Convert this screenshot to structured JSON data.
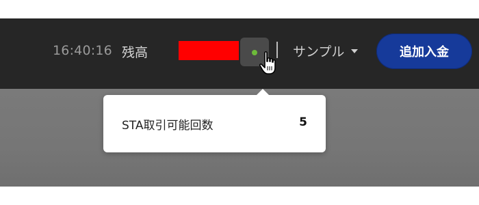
{
  "header": {
    "time": "16:40:16",
    "balance_label": "残高",
    "status_icon": "status-dot-icon",
    "account_name": "サンプル",
    "deposit_label": "追加入金"
  },
  "popover": {
    "label": "STA取引可能回数",
    "value": "5"
  },
  "colors": {
    "topbar": "#262626",
    "deposit_button": "#163a9a",
    "status_dot": "#6dbb3a",
    "redaction": "#ff0000"
  }
}
